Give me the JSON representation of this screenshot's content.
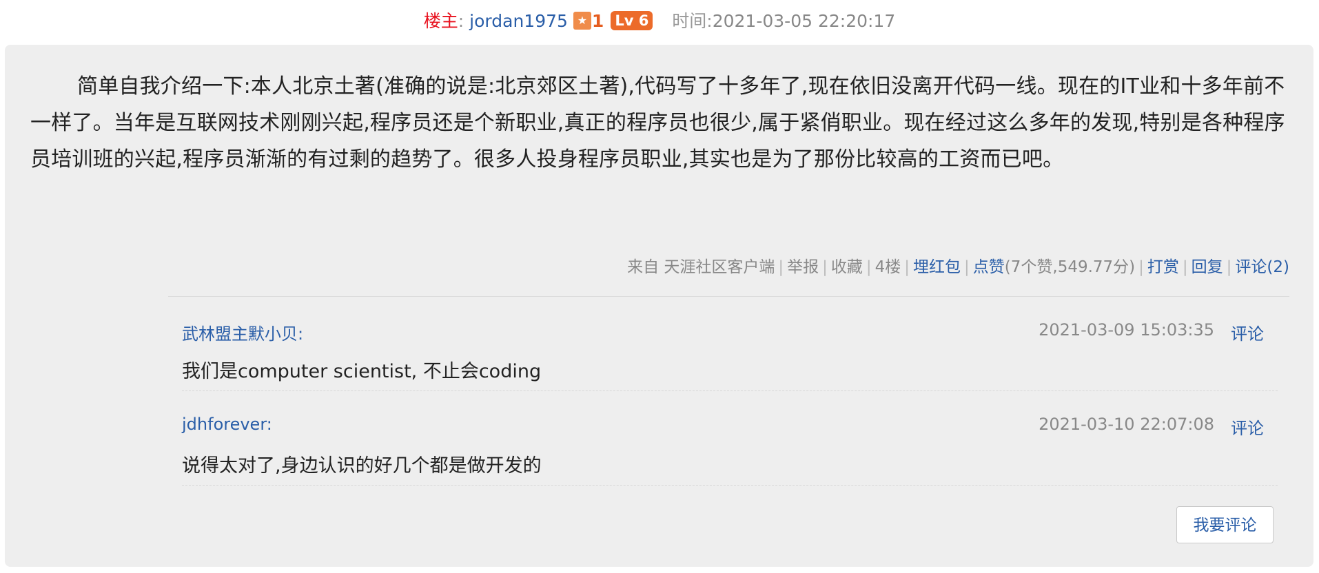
{
  "header": {
    "owner_label": "楼主",
    "colon": ":",
    "username": "jordan1975",
    "star_count": "1",
    "level": "Lv 6",
    "time_label": "时间:",
    "time_value": "2021-03-05 22:20:17"
  },
  "post": {
    "body": "简单自我介绍一下:本人北京土著(准确的说是:北京郊区土著),代码写了十多年了,现在依旧没离开代码一线。现在的IT业和十多年前不一样了。当年是互联网技术刚刚兴起,程序员还是个新职业,真正的程序员也很少,属于紧俏职业。现在经过这么多年的发现,特别是各种程序员培训班的兴起,程序员渐渐的有过剩的趋势了。很多人投身程序员职业,其实也是为了那份比较高的工资而已吧。"
  },
  "meta": {
    "source": "来自 天涯社区客户端",
    "report": "举报",
    "favorite": "收藏",
    "floor": "4楼",
    "red_packet": "埋红包",
    "like": "点赞",
    "like_stats": "(7个赞,549.77分)",
    "tip": "打赏",
    "reply": "回复",
    "comment": "评论(2)"
  },
  "comments": [
    {
      "user": "武林盟主默小贝:",
      "time": "2021-03-09 15:03:35",
      "reply_label": "评论",
      "text": "我们是computer scientist, 不止会coding"
    },
    {
      "user": "jdhforever:",
      "time": "2021-03-10 22:07:08",
      "reply_label": "评论",
      "text": "说得太对了,身边认识的好几个都是做开发的"
    }
  ],
  "actions": {
    "write_comment": "我要评论"
  },
  "colors": {
    "link_blue": "#2a5ea8",
    "owner_red": "#e8101d",
    "badge_orange": "#ec6b2a",
    "panel_gray": "#eeeeee"
  },
  "icons": {
    "star_badge": "star-icon"
  }
}
